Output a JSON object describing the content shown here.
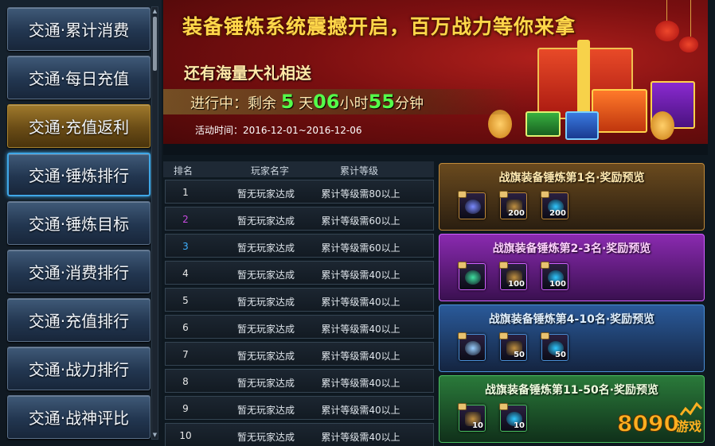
{
  "sidebar": {
    "items": [
      {
        "label": "交通·累计消费"
      },
      {
        "label": "交通·每日充值"
      },
      {
        "label": "交通·充值返利"
      },
      {
        "label": "交通·锤炼排行"
      },
      {
        "label": "交通·锤炼目标"
      },
      {
        "label": "交通·消费排行"
      },
      {
        "label": "交通·充值排行"
      },
      {
        "label": "交通·战力排行"
      },
      {
        "label": "交通·战神评比"
      }
    ]
  },
  "banner": {
    "title": "装备锤炼系统震撼开启，百万战力等你来拿",
    "subtitle": "还有海量大礼相送",
    "countdown": {
      "prefix": "进行中：剩余",
      "days": "5",
      "days_unit": "天",
      "hours": "06",
      "hours_unit": "小时",
      "minutes": "55",
      "minutes_unit": "分钟"
    },
    "period": "活动时间：2016-12-01~2016-12-06"
  },
  "table": {
    "headers": [
      "排名",
      "玩家名字",
      "累计等级"
    ],
    "rows": [
      {
        "rank": "1",
        "player": "暂无玩家达成",
        "requirement": "累计等级需80以上",
        "rank_color": "#e8e8e8"
      },
      {
        "rank": "2",
        "player": "暂无玩家达成",
        "requirement": "累计等级需60以上",
        "rank_color": "#c84ae0"
      },
      {
        "rank": "3",
        "player": "暂无玩家达成",
        "requirement": "累计等级需60以上",
        "rank_color": "#3fb0ff"
      },
      {
        "rank": "4",
        "player": "暂无玩家达成",
        "requirement": "累计等级需40以上",
        "rank_color": "#e8e8e8"
      },
      {
        "rank": "5",
        "player": "暂无玩家达成",
        "requirement": "累计等级需40以上",
        "rank_color": "#e8e8e8"
      },
      {
        "rank": "6",
        "player": "暂无玩家达成",
        "requirement": "累计等级需40以上",
        "rank_color": "#e8e8e8"
      },
      {
        "rank": "7",
        "player": "暂无玩家达成",
        "requirement": "累计等级需40以上",
        "rank_color": "#e8e8e8"
      },
      {
        "rank": "8",
        "player": "暂无玩家达成",
        "requirement": "累计等级需40以上",
        "rank_color": "#e8e8e8"
      },
      {
        "rank": "9",
        "player": "暂无玩家达成",
        "requirement": "累计等级需40以上",
        "rank_color": "#e8e8e8"
      },
      {
        "rank": "10",
        "player": "暂无玩家达成",
        "requirement": "累计等级需40以上",
        "rank_color": "#e8e8e8"
      }
    ]
  },
  "rewards": [
    {
      "title": "战旗装备锤炼第1名·奖励预览",
      "theme": "gold",
      "items": [
        {
          "icon": "weapon-icon",
          "count": ""
        },
        {
          "icon": "chest-icon",
          "count": "200"
        },
        {
          "icon": "gem-icon",
          "count": "200"
        }
      ]
    },
    {
      "title": "战旗装备锤炼第2-3名·奖励预览",
      "theme": "purple",
      "items": [
        {
          "icon": "armor-icon",
          "count": ""
        },
        {
          "icon": "chest-icon",
          "count": "100"
        },
        {
          "icon": "gem-icon",
          "count": "100"
        }
      ]
    },
    {
      "title": "战旗装备锤炼第4-10名·奖励预览",
      "theme": "blue",
      "items": [
        {
          "icon": "crystal-icon",
          "count": ""
        },
        {
          "icon": "chest-icon",
          "count": "50"
        },
        {
          "icon": "gem-icon",
          "count": "50"
        }
      ]
    },
    {
      "title": "战旗装备锤炼第11-50名·奖励预览",
      "theme": "green",
      "items": [
        {
          "icon": "chest-icon",
          "count": "10"
        },
        {
          "icon": "gem-icon",
          "count": "10"
        }
      ]
    }
  ],
  "watermark": {
    "text": "8090游戏"
  },
  "colors": {
    "countdown_number": "#55ff4a",
    "title_gold": "#ffd84a",
    "active_border": "#3fa7e6"
  }
}
